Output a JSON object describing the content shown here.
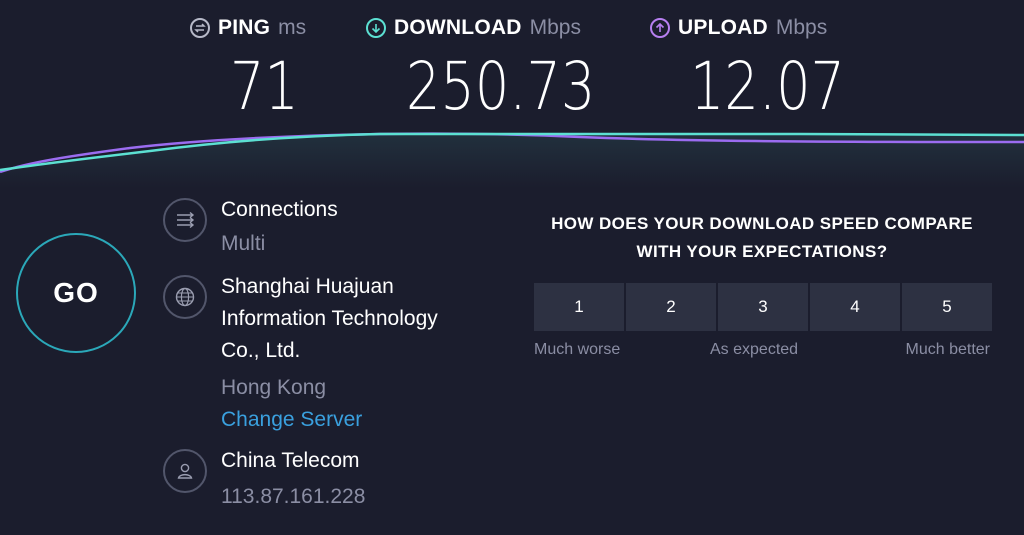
{
  "metrics": [
    {
      "id": "ping",
      "label": "PING",
      "unit": "ms",
      "value": "71",
      "icon": "ping-icon",
      "color": "#b7b9c8"
    },
    {
      "id": "download",
      "label": "DOWNLOAD",
      "unit": "Mbps",
      "value": "250.73",
      "icon": "download-arrow-icon",
      "color": "#5ce0d2"
    },
    {
      "id": "upload",
      "label": "UPLOAD",
      "unit": "Mbps",
      "value": "12.07",
      "icon": "upload-arrow-icon",
      "color": "#b77ff0"
    }
  ],
  "graph": {
    "download_color": "#5ce0d2",
    "upload_color": "#9b6cf0"
  },
  "go": {
    "label": "GO"
  },
  "connections": {
    "label": "Connections",
    "value": "Multi",
    "icon": "connections-icon"
  },
  "server": {
    "provider_lines": [
      "Shanghai Huajuan",
      "Information Technology",
      "Co., Ltd."
    ],
    "location": "Hong Kong",
    "change_label": "Change Server",
    "icon": "globe-icon"
  },
  "isp": {
    "name": "China Telecom",
    "ip": "113.87.161.228",
    "icon": "user-icon"
  },
  "survey": {
    "title_lines": [
      "HOW DOES YOUR DOWNLOAD SPEED COMPARE",
      "WITH YOUR EXPECTATIONS?"
    ],
    "options": [
      "1",
      "2",
      "3",
      "4",
      "5"
    ],
    "scale_labels": [
      "Much worse",
      "As expected",
      "Much better"
    ]
  },
  "colors": {
    "background": "#1b1d2d",
    "accent_link": "#3aa0de",
    "go_ring": "#2ba8b9",
    "button_bg": "#2d3142"
  }
}
